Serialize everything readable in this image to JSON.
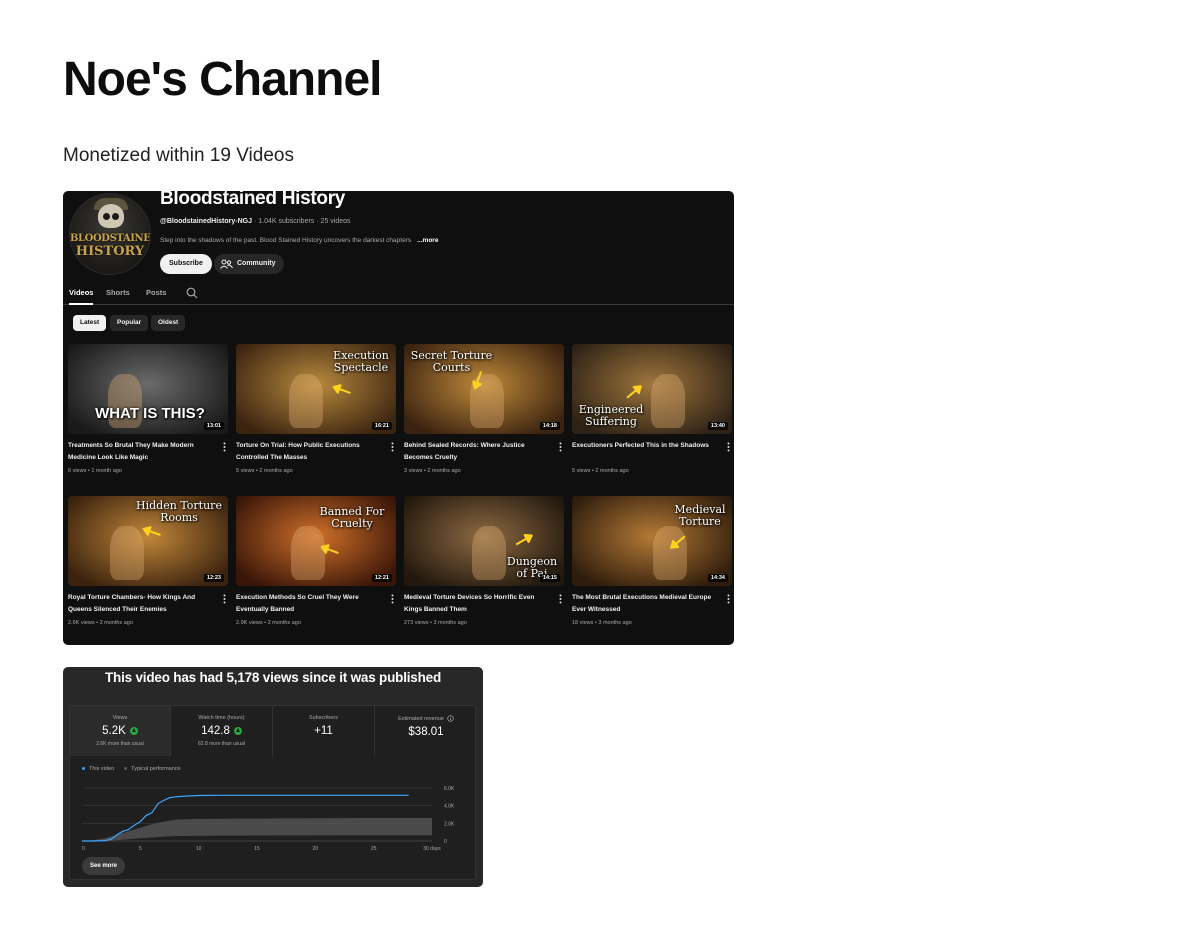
{
  "page": {
    "title": "Noe's Channel",
    "subtitle": "Monetized within 19 Videos"
  },
  "channel": {
    "avatar_text_1": "BLOODSTAINED",
    "avatar_text_2": "HISTORY",
    "name": "Bloodstained History",
    "handle": "@BloodstainedHistory-NGJ",
    "subscribers": "1.04K subscribers",
    "videos_count": "25 videos",
    "separator": "·",
    "description": "Step into the shadows of the past. Blood Stained History uncovers the darkest chapters",
    "more": "...more",
    "subscribe_label": "Subscribe",
    "community_label": "Community",
    "tabs": [
      "Videos",
      "Shorts",
      "Posts"
    ],
    "chips": [
      "Latest",
      "Popular",
      "Oldest"
    ],
    "videos": [
      {
        "overlay": "WHAT IS THIS?",
        "duration": "13:01",
        "title": "Treatments So Brutal They Make Modern Medicine Look Like Magic",
        "meta": "6 views • 1 month ago",
        "colors": [
          "#6b6b6b",
          "#1a1a1a"
        ]
      },
      {
        "overlay": "Execution Spectacle",
        "duration": "16:21",
        "title": "Torture On Trial: How Public Executions Controlled The Masses",
        "meta": "5 views • 2 months ago",
        "colors": [
          "#b98a3e",
          "#3b2410"
        ]
      },
      {
        "overlay": "Secret Torture Courts",
        "duration": "14:18",
        "title": "Behind Sealed Records: Where Justice Becomes Cruelty",
        "meta": "3 views • 2 months ago",
        "colors": [
          "#c08a3a",
          "#3a2210"
        ]
      },
      {
        "overlay": "Engineered Suffering",
        "duration": "13:40",
        "title": "Executioners Perfected This in the Shadows",
        "meta": "5 views • 2 months ago",
        "colors": [
          "#a0763c",
          "#2e2216"
        ]
      },
      {
        "overlay": "Hidden Torture Rooms",
        "duration": "12:23",
        "title": "Royal Torture Chambers- How Kings And Queens Silenced Their Enemies",
        "meta": "2.6K views • 2 months ago",
        "colors": [
          "#c2873a",
          "#3a220e"
        ]
      },
      {
        "overlay": "Banned For Cruelty",
        "duration": "12:21",
        "title": "Execution Methods So Cruel They Were Eventually Banned",
        "meta": "2.9K views • 2 months ago",
        "colors": [
          "#d0702a",
          "#3a1608"
        ]
      },
      {
        "overlay": "Dungeon of Pai",
        "duration": "14:15",
        "title": "Medieval Torture Devices So Horrific Even Kings Banned Them",
        "meta": "273 views • 3 months ago",
        "colors": [
          "#8e6a42",
          "#22180e"
        ]
      },
      {
        "overlay": "Medieval Torture",
        "duration": "14:34",
        "title": "The Most Brutal Executions Medieval Europe Ever Witnessed",
        "meta": "18 views • 3 months ago",
        "colors": [
          "#b47a36",
          "#2e1c0c"
        ]
      }
    ]
  },
  "analytics": {
    "headline": "This video has had 5,178 views since it was published",
    "metrics": [
      {
        "label": "Views",
        "value": "5.2K",
        "sub": "2.6K more than usual",
        "up": true
      },
      {
        "label": "Watch time (hours)",
        "value": "142.8",
        "sub": "62.8 more than usual",
        "up": true
      },
      {
        "label": "Subscribers",
        "value": "+11",
        "sub": "",
        "up": false
      },
      {
        "label": "Estimated revenue",
        "value": "$38.01",
        "sub": "",
        "up": false,
        "info": true
      }
    ],
    "legend": {
      "this_video": "This video",
      "typical": "Typical performance"
    },
    "see_more": "See more",
    "colors": {
      "this_video": "#3ea6ff",
      "typical": "#5a5a5a",
      "up": "#2ba640"
    }
  },
  "chart_data": {
    "type": "line",
    "x_tick_labels": [
      "0",
      "5",
      "10",
      "15",
      "20",
      "25",
      "30 days"
    ],
    "y_tick_labels": [
      "6.0K",
      "4.0K",
      "2.0K",
      "0"
    ],
    "xlim": [
      0,
      30
    ],
    "ylim": [
      0,
      6000
    ],
    "grid": true,
    "legend_position": "top-left",
    "series": [
      {
        "name": "This video",
        "x": [
          0,
          1,
          2,
          2.5,
          3,
          3.5,
          4,
          4.5,
          5,
          5.5,
          6,
          6.5,
          7,
          7.5,
          8,
          9,
          10,
          12,
          15,
          20,
          25,
          28
        ],
        "y": [
          0,
          0,
          50,
          200,
          700,
          1100,
          1300,
          1800,
          2200,
          2900,
          3200,
          4200,
          4600,
          4900,
          5000,
          5100,
          5150,
          5170,
          5175,
          5178,
          5178,
          5178
        ]
      }
    ],
    "band": {
      "name": "Typical performance",
      "x": [
        0,
        1,
        2,
        3,
        4,
        5,
        6,
        7,
        8,
        10,
        15,
        20,
        25,
        30
      ],
      "upper": [
        0,
        100,
        300,
        700,
        1100,
        1500,
        1900,
        2200,
        2400,
        2500,
        2550,
        2580,
        2600,
        2600
      ],
      "lower": [
        0,
        0,
        0,
        100,
        200,
        300,
        400,
        500,
        550,
        600,
        620,
        630,
        640,
        640
      ]
    }
  }
}
